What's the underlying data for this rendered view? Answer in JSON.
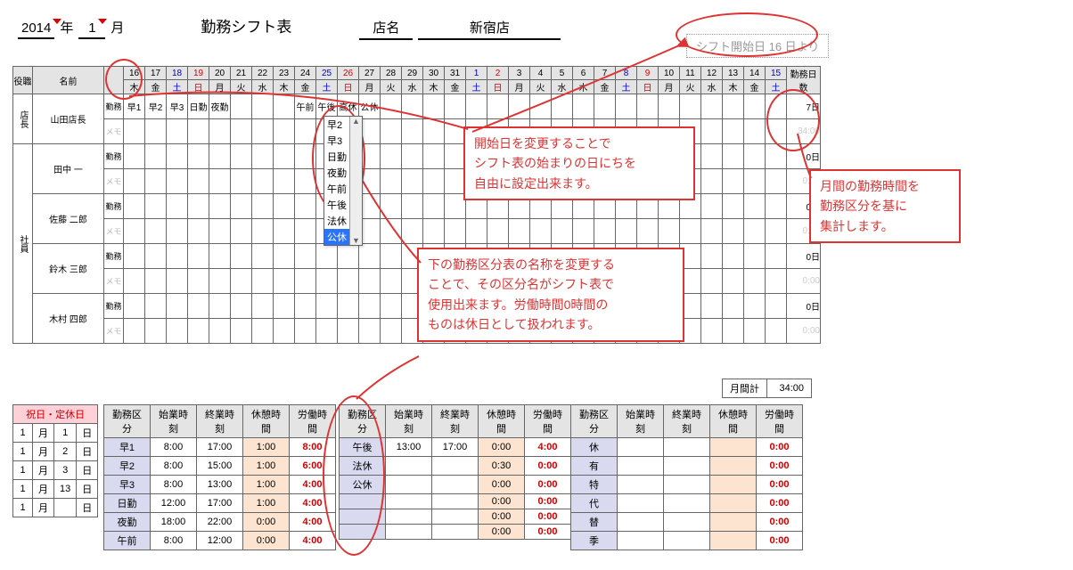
{
  "header": {
    "year": "2014",
    "year_label": "年",
    "month": "1",
    "month_label": "月",
    "title": "勤務シフト表",
    "store_label": "店名",
    "store_name": "新宿店",
    "shift_start_text": "シフト開始日 16 日より"
  },
  "columns": {
    "role": "役職",
    "name": "名前",
    "total": "勤務日数"
  },
  "days": [
    {
      "d": "16",
      "w": "木",
      "cls": ""
    },
    {
      "d": "17",
      "w": "金",
      "cls": ""
    },
    {
      "d": "18",
      "w": "土",
      "cls": "sat"
    },
    {
      "d": "19",
      "w": "日",
      "cls": "sun"
    },
    {
      "d": "20",
      "w": "月",
      "cls": ""
    },
    {
      "d": "21",
      "w": "火",
      "cls": ""
    },
    {
      "d": "22",
      "w": "水",
      "cls": ""
    },
    {
      "d": "23",
      "w": "木",
      "cls": ""
    },
    {
      "d": "24",
      "w": "金",
      "cls": ""
    },
    {
      "d": "25",
      "w": "土",
      "cls": "sat"
    },
    {
      "d": "26",
      "w": "日",
      "cls": "sun"
    },
    {
      "d": "27",
      "w": "月",
      "cls": ""
    },
    {
      "d": "28",
      "w": "火",
      "cls": ""
    },
    {
      "d": "29",
      "w": "水",
      "cls": ""
    },
    {
      "d": "30",
      "w": "木",
      "cls": ""
    },
    {
      "d": "31",
      "w": "金",
      "cls": ""
    },
    {
      "d": "1",
      "w": "土",
      "cls": "sat"
    },
    {
      "d": "2",
      "w": "日",
      "cls": "sun"
    },
    {
      "d": "3",
      "w": "月",
      "cls": ""
    },
    {
      "d": "4",
      "w": "火",
      "cls": ""
    },
    {
      "d": "5",
      "w": "水",
      "cls": ""
    },
    {
      "d": "6",
      "w": "木",
      "cls": ""
    },
    {
      "d": "7",
      "w": "金",
      "cls": ""
    },
    {
      "d": "8",
      "w": "土",
      "cls": "sat"
    },
    {
      "d": "9",
      "w": "日",
      "cls": "sun"
    },
    {
      "d": "10",
      "w": "月",
      "cls": ""
    },
    {
      "d": "11",
      "w": "火",
      "cls": ""
    },
    {
      "d": "12",
      "w": "水",
      "cls": ""
    },
    {
      "d": "13",
      "w": "木",
      "cls": ""
    },
    {
      "d": "14",
      "w": "金",
      "cls": ""
    },
    {
      "d": "15",
      "w": "土",
      "cls": "sat"
    }
  ],
  "rowlabels": {
    "work": "勤務",
    "memo": "メモ"
  },
  "staff": [
    {
      "role": "店長",
      "name": "山田店長",
      "cells": [
        "早1",
        "早2",
        "早3",
        "日勤",
        "夜勤",
        "",
        "",
        "",
        "午前",
        "午後",
        "高休",
        "公休",
        "",
        "",
        "",
        "",
        "",
        "",
        "",
        "",
        "",
        "",
        "",
        "",
        "",
        "",
        "",
        "",
        "",
        "",
        ""
      ],
      "days": "7日",
      "hours": "34:00"
    },
    {
      "role": "社員",
      "name": "田中 一",
      "cells": [
        "",
        "",
        "",
        "",
        "",
        "",
        "",
        "",
        "",
        "",
        "",
        "",
        "",
        "",
        "",
        "",
        "",
        "",
        "",
        "",
        "",
        "",
        "",
        "",
        "",
        "",
        "",
        "",
        "",
        "",
        ""
      ],
      "days": "0日",
      "hours": "0:00"
    },
    {
      "role": "",
      "name": "佐藤 二郎",
      "cells": [
        "",
        "",
        "",
        "",
        "",
        "",
        "",
        "",
        "",
        "",
        "",
        "",
        "",
        "",
        "",
        "",
        "",
        "",
        "",
        "",
        "",
        "",
        "",
        "",
        "",
        "",
        "",
        "",
        "",
        "",
        ""
      ],
      "days": "0日",
      "hours": "0:00"
    },
    {
      "role": "",
      "name": "鈴木 三郎",
      "cells": [
        "",
        "",
        "",
        "",
        "",
        "",
        "",
        "",
        "",
        "",
        "",
        "",
        "",
        "",
        "",
        "",
        "",
        "",
        "",
        "",
        "",
        "",
        "",
        "",
        "",
        "",
        "",
        "",
        "",
        "",
        ""
      ],
      "days": "0日",
      "hours": "0:00"
    },
    {
      "role": "",
      "name": "木村 四郎",
      "cells": [
        "",
        "",
        "",
        "",
        "",
        "",
        "",
        "",
        "",
        "",
        "",
        "",
        "",
        "",
        "",
        "",
        "",
        "",
        "",
        "",
        "",
        "",
        "",
        "",
        "",
        "",
        "",
        "",
        "",
        "",
        ""
      ],
      "days": "0日",
      "hours": "0:00"
    }
  ],
  "dropdown": {
    "options": [
      "早2",
      "早3",
      "日勤",
      "夜勤",
      "午前",
      "午後",
      "法休",
      "公休"
    ],
    "selected": "公休"
  },
  "month_total": {
    "label": "月間計",
    "value": "34:00"
  },
  "holidays": {
    "header": "祝日・定休日",
    "rows": [
      {
        "m": "1",
        "ml": "月",
        "d": "1",
        "dl": "日"
      },
      {
        "m": "1",
        "ml": "月",
        "d": "2",
        "dl": "日"
      },
      {
        "m": "1",
        "ml": "月",
        "d": "3",
        "dl": "日"
      },
      {
        "m": "1",
        "ml": "月",
        "d": "13",
        "dl": "日"
      },
      {
        "m": "1",
        "ml": "月",
        "d": "",
        "dl": "日"
      }
    ]
  },
  "legend_header": [
    "勤務区分",
    "始業時刻",
    "終業時刻",
    "休憩時間",
    "労働時間"
  ],
  "legend1": [
    {
      "n": "早1",
      "s": "8:00",
      "e": "17:00",
      "r": "1:00",
      "t": "8:00"
    },
    {
      "n": "早2",
      "s": "8:00",
      "e": "15:00",
      "r": "1:00",
      "t": "6:00"
    },
    {
      "n": "早3",
      "s": "8:00",
      "e": "13:00",
      "r": "1:00",
      "t": "4:00"
    },
    {
      "n": "日勤",
      "s": "12:00",
      "e": "17:00",
      "r": "1:00",
      "t": "4:00"
    },
    {
      "n": "夜勤",
      "s": "18:00",
      "e": "22:00",
      "r": "0:00",
      "t": "4:00"
    },
    {
      "n": "午前",
      "s": "8:00",
      "e": "12:00",
      "r": "0:00",
      "t": "4:00"
    }
  ],
  "legend2": [
    {
      "n": "午後",
      "s": "13:00",
      "e": "17:00",
      "r": "0:00",
      "t": "4:00"
    },
    {
      "n": "法休",
      "s": "",
      "e": "",
      "r": "0:30",
      "t": "0:00"
    },
    {
      "n": "公休",
      "s": "",
      "e": "",
      "r": "0:00",
      "t": "0:00"
    },
    {
      "n": "",
      "s": "",
      "e": "",
      "r": "0:00",
      "t": "0:00"
    },
    {
      "n": "",
      "s": "",
      "e": "",
      "r": "0:00",
      "t": "0:00"
    },
    {
      "n": "",
      "s": "",
      "e": "",
      "r": "0:00",
      "t": "0:00"
    }
  ],
  "legend3": [
    {
      "n": "休",
      "s": "",
      "e": "",
      "r": "",
      "t": "0:00"
    },
    {
      "n": "有",
      "s": "",
      "e": "",
      "r": "",
      "t": "0:00"
    },
    {
      "n": "特",
      "s": "",
      "e": "",
      "r": "",
      "t": "0:00"
    },
    {
      "n": "代",
      "s": "",
      "e": "",
      "r": "",
      "t": "0:00"
    },
    {
      "n": "替",
      "s": "",
      "e": "",
      "r": "",
      "t": "0:00"
    },
    {
      "n": "季",
      "s": "",
      "e": "",
      "r": "",
      "t": "0:00"
    }
  ],
  "annotations": {
    "a1": "開始日を変更することで\nシフト表の始まりの日にちを\n自由に設定出来ます。",
    "a2": "下の勤務区分表の名称を変更する\nことで、その区分名がシフト表で\n使用出来ます。労働時間0時間の\nものは休日として扱われます。",
    "a3": "月間の勤務時間を\n勤務区分を基に\n集計します。"
  }
}
